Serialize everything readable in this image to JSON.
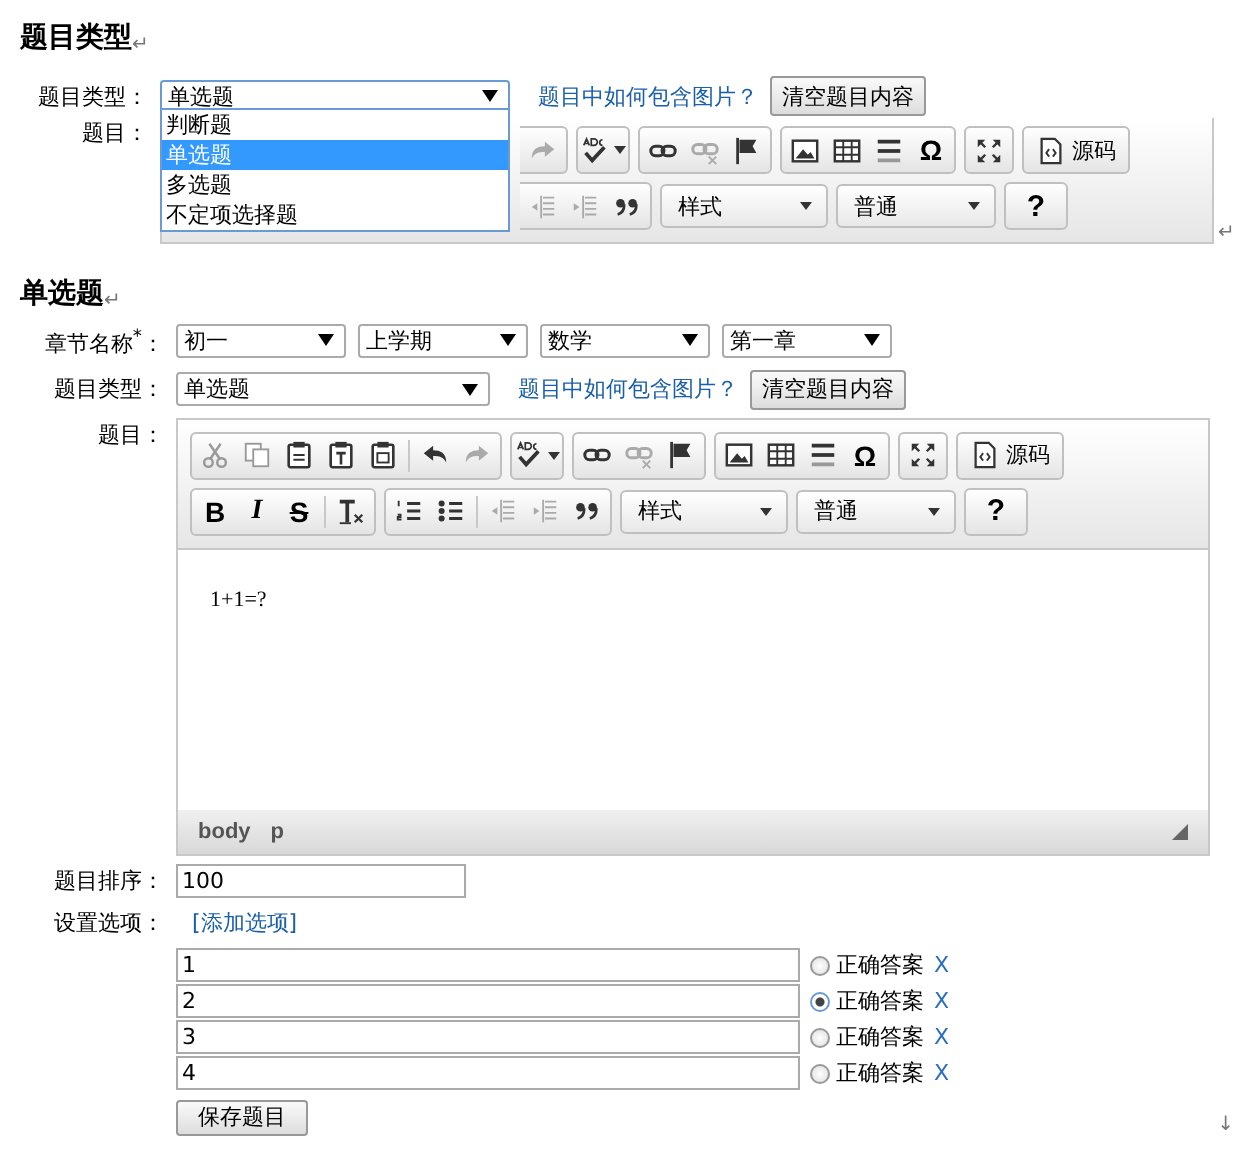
{
  "type_section": {
    "heading": "题目类型",
    "heading_mark": "↵",
    "type_label": "题目类型：",
    "type_value": "单选题",
    "dropdown_options": [
      {
        "label": "判断题",
        "selected": false
      },
      {
        "label": "单选题",
        "selected": true
      },
      {
        "label": "多选题",
        "selected": false
      },
      {
        "label": "不定项选择题",
        "selected": false
      }
    ],
    "image_help_link": "题目中如何包含图片？",
    "clear_button": "清空题目内容",
    "question_label": "题目：",
    "toolbar": {
      "omega": "Ω",
      "source": "源码",
      "style": "样式",
      "format": "普通",
      "help": "?"
    },
    "end_mark": "↵"
  },
  "question_section": {
    "heading": "单选题",
    "heading_mark": "↵",
    "chapter_label": "章节名称$^{*}$：",
    "chapter_selects": [
      "初一",
      "上学期",
      "数学",
      "第一章"
    ],
    "type_label": "题目类型：",
    "type_value": "单选题",
    "image_help_link": "题目中如何包含图片？",
    "clear_button": "清空题目内容",
    "question_label": "题目：",
    "editor": {
      "toolbar": {
        "bold": "B",
        "italic": "I",
        "strike": "S",
        "omega": "Ω",
        "source": "源码",
        "style": "样式",
        "format": "普通",
        "help": "?"
      },
      "content": "1+1=?",
      "path": [
        "body",
        "p"
      ]
    },
    "order_label": "题目排序：",
    "order_value": "100",
    "options_label": "设置选项：",
    "add_option_link": "[添加选项]",
    "options": [
      {
        "value": "1",
        "selected": false,
        "answer_label": "正确答案",
        "remove": "X"
      },
      {
        "value": "2",
        "selected": true,
        "answer_label": "正确答案",
        "remove": "X"
      },
      {
        "value": "3",
        "selected": false,
        "answer_label": "正确答案",
        "remove": "X"
      },
      {
        "value": "4",
        "selected": false,
        "answer_label": "正确答案",
        "remove": "X"
      }
    ],
    "save_button": "保存题目",
    "end_mark": "↓"
  }
}
